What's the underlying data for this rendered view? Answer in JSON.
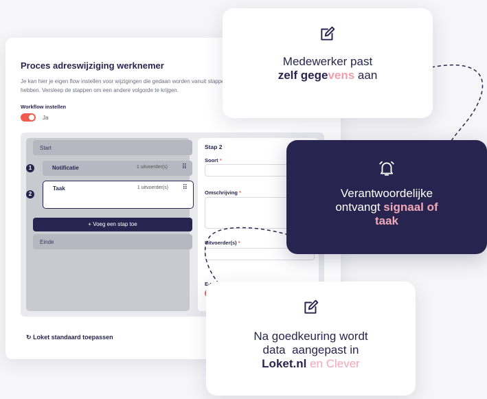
{
  "app": {
    "title": "Proces adreswijziging werknemer",
    "description": "Je kan hier je eigen flow instellen voor wijzigingen die gedaan worden vanuit stappen hebben. Versleep de stappen om een andere volgorde te krijgen.",
    "workflow_label": "Workflow instellen",
    "toggle_label": "Ja",
    "steps": {
      "start": "Start",
      "step1_num": "1",
      "step1_name": "Notificatie",
      "step1_count": "1 uitvoerder(s)",
      "step2_num": "2",
      "step2_name": "Taak",
      "step2_count": "1 uitvoerder(s)",
      "add_button": "+ Voeg een stap toe",
      "end": "Einde"
    },
    "detail": {
      "heading": "Stap 2",
      "soort_label": "Soort",
      "omschrijving_label": "Omschrijving",
      "uitvoerders_label": "Uitvoerder(s)",
      "email_label": "E-m",
      "required": "*"
    },
    "reset_label": "Loket standaard toepassen"
  },
  "cards": {
    "card1": {
      "line1": "Medewerker past",
      "bold": "zelf gege",
      "fade": "vens",
      "tail": " aan"
    },
    "card2": {
      "line1": "Verantwoordelijke",
      "line2": "ontvangt ",
      "pink": "signaal of",
      "pink2": "taak"
    },
    "card3": {
      "line1": "Na goedkeuring wordt",
      "line2": "data  aangepast in",
      "bold": "Loket.nl",
      "pink": " en Clever"
    }
  },
  "icons": [
    "edit-icon",
    "alarm-bell-icon",
    "reset-icon",
    "grip-icon"
  ],
  "colors": {
    "navy": "#27254f",
    "accent_red": "#ef5b4c",
    "pink": "#f2a7b6"
  }
}
